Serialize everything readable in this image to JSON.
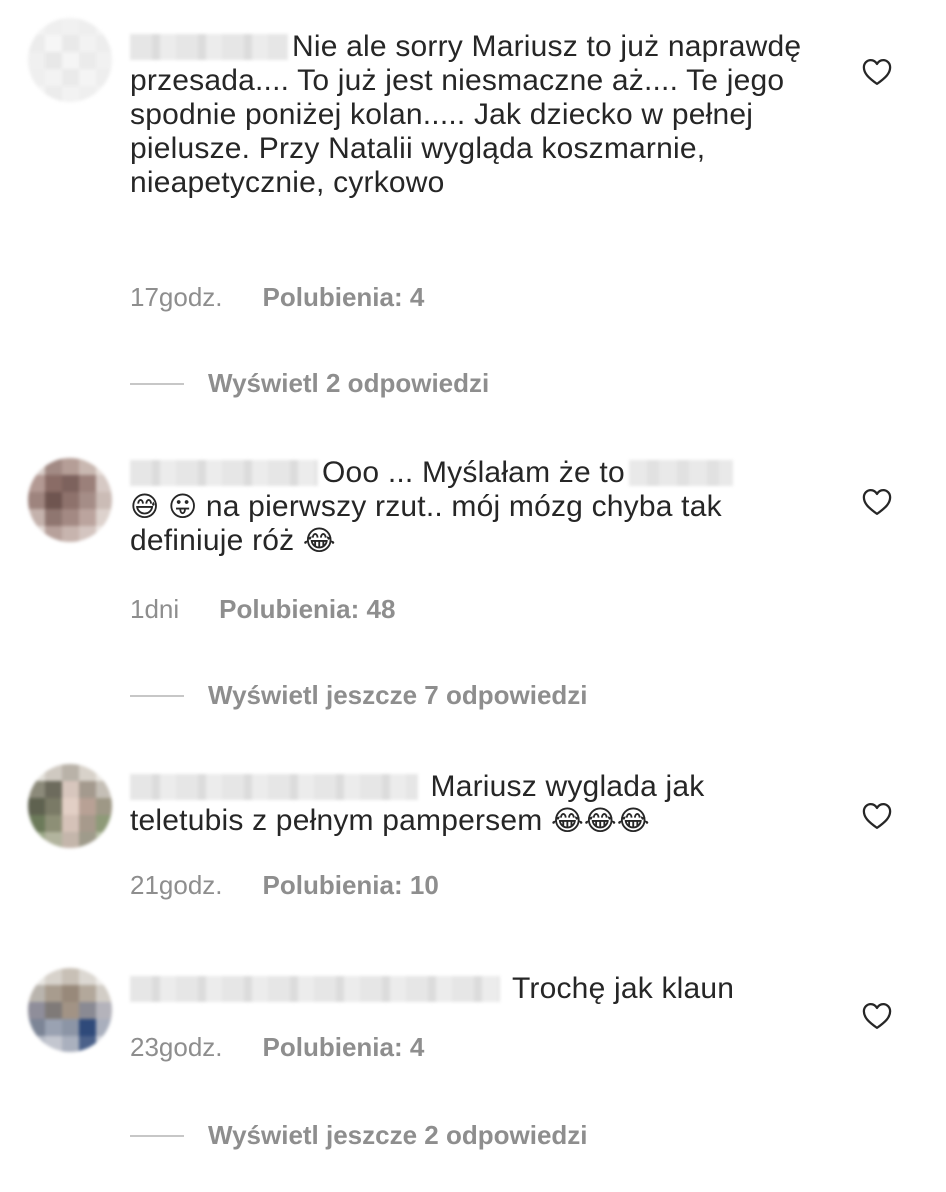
{
  "comments": [
    {
      "text": "Nie ale sorry Mariusz to już naprawdę przesada.... To już jest niesmaczne aż.... Te jego spodnie poniżej kolan..... Jak dziecko w pełnej pieluszе. Przy Natalii wygląda koszmarnie, nieapetycznie, cyrkowo",
      "time": "17godz.",
      "likes": "Polubienia: 4",
      "replies": "Wyświetl 2 odpowiedzi"
    },
    {
      "text_a": "Ooo ... Myślałam że to",
      "text_b": "na pierwszy rzut.. mój mózg chyba tak definiuje róż",
      "emoji_a": "😅",
      "emoji_b": "😛",
      "emoji_c": "😂",
      "time": "1dni",
      "likes": "Polubienia: 48",
      "replies": "Wyświetl jeszcze 7 odpowiedzi"
    },
    {
      "text": "Mariusz wyglada jak teletubis z pełnym pampersem",
      "emoji": "😂😂😂",
      "time": "21godz.",
      "likes": "Polubienia: 10"
    },
    {
      "text": "Trochę jak klaun",
      "time": "23godz.",
      "likes": "Polubienia: 4",
      "replies": "Wyświetl jeszcze 2 odpowiedzi"
    }
  ],
  "icons": {
    "like": "heart-outline-icon"
  },
  "colors": {
    "text": "#262626",
    "meta": "#8e8e8e",
    "reply_line": "#c7c7c7"
  }
}
